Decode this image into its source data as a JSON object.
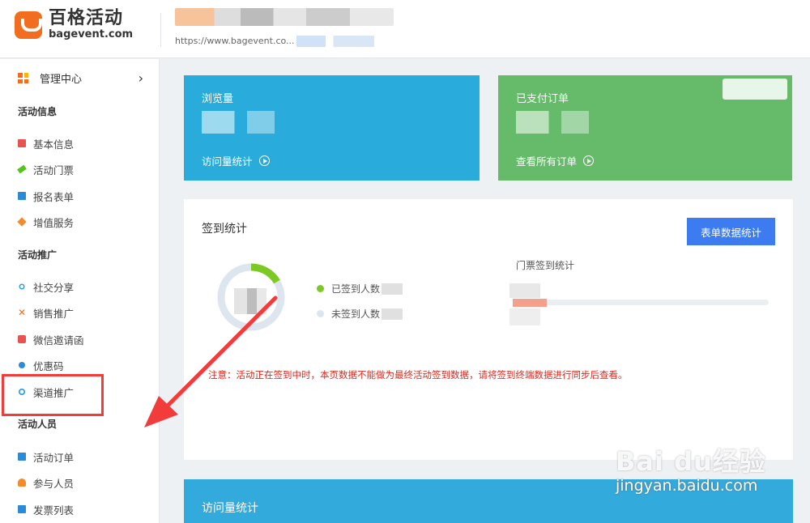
{
  "brand": {
    "name_cn": "百格活动",
    "name_en": "bagevent.com"
  },
  "event": {
    "url": "https://www.bagevent.co..."
  },
  "sidebar": {
    "manage_label": "管理中心",
    "sections": {
      "info": "活动信息",
      "promo": "活动推广",
      "people": "活动人员"
    },
    "items": [
      {
        "label": "基本信息",
        "icon": "doc-icon",
        "color": "#e8524f"
      },
      {
        "label": "活动门票",
        "icon": "ticket-icon",
        "color": "#52c41a"
      },
      {
        "label": "报名表单",
        "icon": "form-icon",
        "color": "#2a8bd8"
      },
      {
        "label": "增值服务",
        "icon": "diamond-icon",
        "color": "#f38b2c"
      },
      {
        "label": "社交分享",
        "icon": "share-icon",
        "color": "#1e9be8"
      },
      {
        "label": "销售推广",
        "icon": "cross-icon",
        "color": "#f36d21"
      },
      {
        "label": "微信邀请函",
        "icon": "invite-icon",
        "color": "#e8524f"
      },
      {
        "label": "优惠码",
        "icon": "coupon-icon",
        "color": "#2a8bd8"
      },
      {
        "label": "渠道推广",
        "icon": "channel-icon",
        "color": "#1e9be8"
      },
      {
        "label": "活动订单",
        "icon": "order-icon",
        "color": "#2a8bd8"
      },
      {
        "label": "参与人员",
        "icon": "user-icon",
        "color": "#f38b2c"
      },
      {
        "label": "发票列表",
        "icon": "invoice-icon",
        "color": "#2a8bd8"
      }
    ]
  },
  "cards": {
    "views": {
      "title": "浏览量",
      "link": "访问量统计"
    },
    "orders": {
      "title": "已支付订单",
      "link": "查看所有订单"
    }
  },
  "checkin": {
    "title": "签到统计",
    "button": "表单数据统计",
    "checked_label": "已签到人数",
    "unchecked_label": "未签到人数",
    "ticket_title": "门票签到统计",
    "notice": "注意：活动正在签到中时，本页数据不能做为最终活动签到数据，请将签到终端数据进行同步后查看。",
    "colors": {
      "checked": "#7cc924",
      "unchecked": "#dde6ee"
    }
  },
  "visits_panel": {
    "title": "访问量统计"
  },
  "watermark": {
    "main": "Bai du经验",
    "url": "jingyan.baidu.com"
  }
}
